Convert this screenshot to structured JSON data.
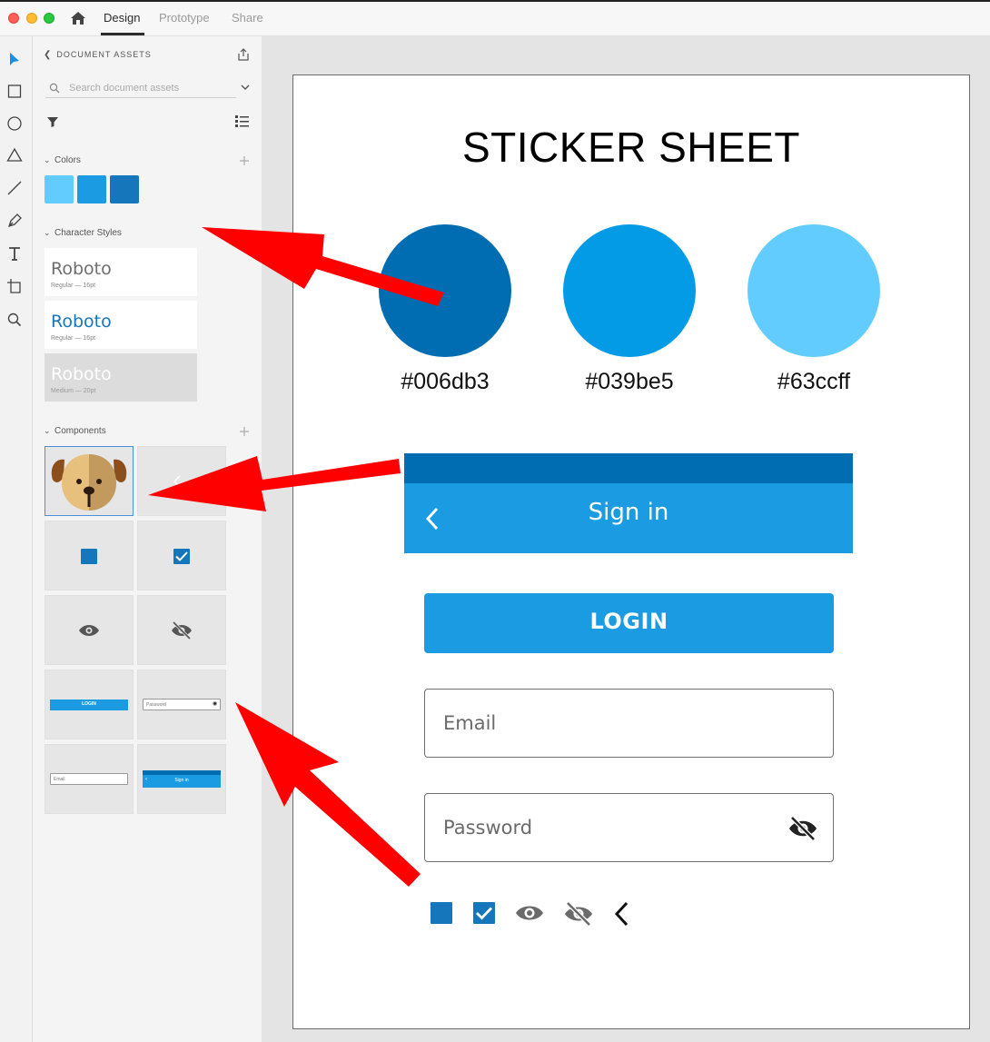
{
  "window": {
    "tabs": [
      {
        "label": "Design",
        "active": true
      },
      {
        "label": "Prototype",
        "active": false
      },
      {
        "label": "Share",
        "active": false
      }
    ]
  },
  "toolbar": {
    "tools": [
      "select-icon",
      "rectangle-icon",
      "ellipse-icon",
      "polygon-icon",
      "line-icon",
      "pen-icon",
      "text-icon",
      "artboard-icon",
      "zoom-icon"
    ]
  },
  "assets_panel": {
    "header": "DOCUMENT ASSETS",
    "search": {
      "placeholder": "Search document assets",
      "value": ""
    },
    "colors_section": {
      "title": "Colors",
      "swatches": [
        "#63ccff",
        "#1b9be2",
        "#1676bc"
      ]
    },
    "character_styles_section": {
      "title": "Character Styles",
      "styles": [
        {
          "name": "Roboto",
          "meta": "Regular — 16pt",
          "color": "#6e6e6e",
          "background": "#ffffff"
        },
        {
          "name": "Roboto",
          "meta": "Regular — 16pt",
          "color": "#1676bc",
          "background": "#ffffff"
        },
        {
          "name": "Roboto",
          "meta": "Medium — 20pt",
          "color": "#ffffff",
          "background": "#dcdcdc"
        }
      ]
    },
    "components_section": {
      "title": "Components",
      "thumbnails": {
        "login_label": "LOGIN",
        "password_label": "Password",
        "email_label": "Email",
        "signin_label": "Sign in"
      }
    }
  },
  "artboard": {
    "title": "STICKER SHEET",
    "colors": [
      {
        "hex": "#006db3",
        "color": "#006db3"
      },
      {
        "hex": "#039be5",
        "color": "#039be5"
      },
      {
        "hex": "#63ccff",
        "color": "#63ccff"
      }
    ],
    "app_bar": {
      "title": "Sign in",
      "status_color": "#006db3",
      "bar_color": "#1b9be2"
    },
    "login_button": {
      "label": "LOGIN"
    },
    "email_field": {
      "placeholder": "Email",
      "value": ""
    },
    "password_field": {
      "placeholder": "Password",
      "value": ""
    },
    "icon_row": [
      "checkbox-unchecked-icon",
      "checkbox-checked-icon",
      "eye-icon",
      "eye-off-icon",
      "chevron-left-icon"
    ]
  },
  "annotations": {
    "arrow_color": "#ff0000",
    "arrow_count": 3
  }
}
